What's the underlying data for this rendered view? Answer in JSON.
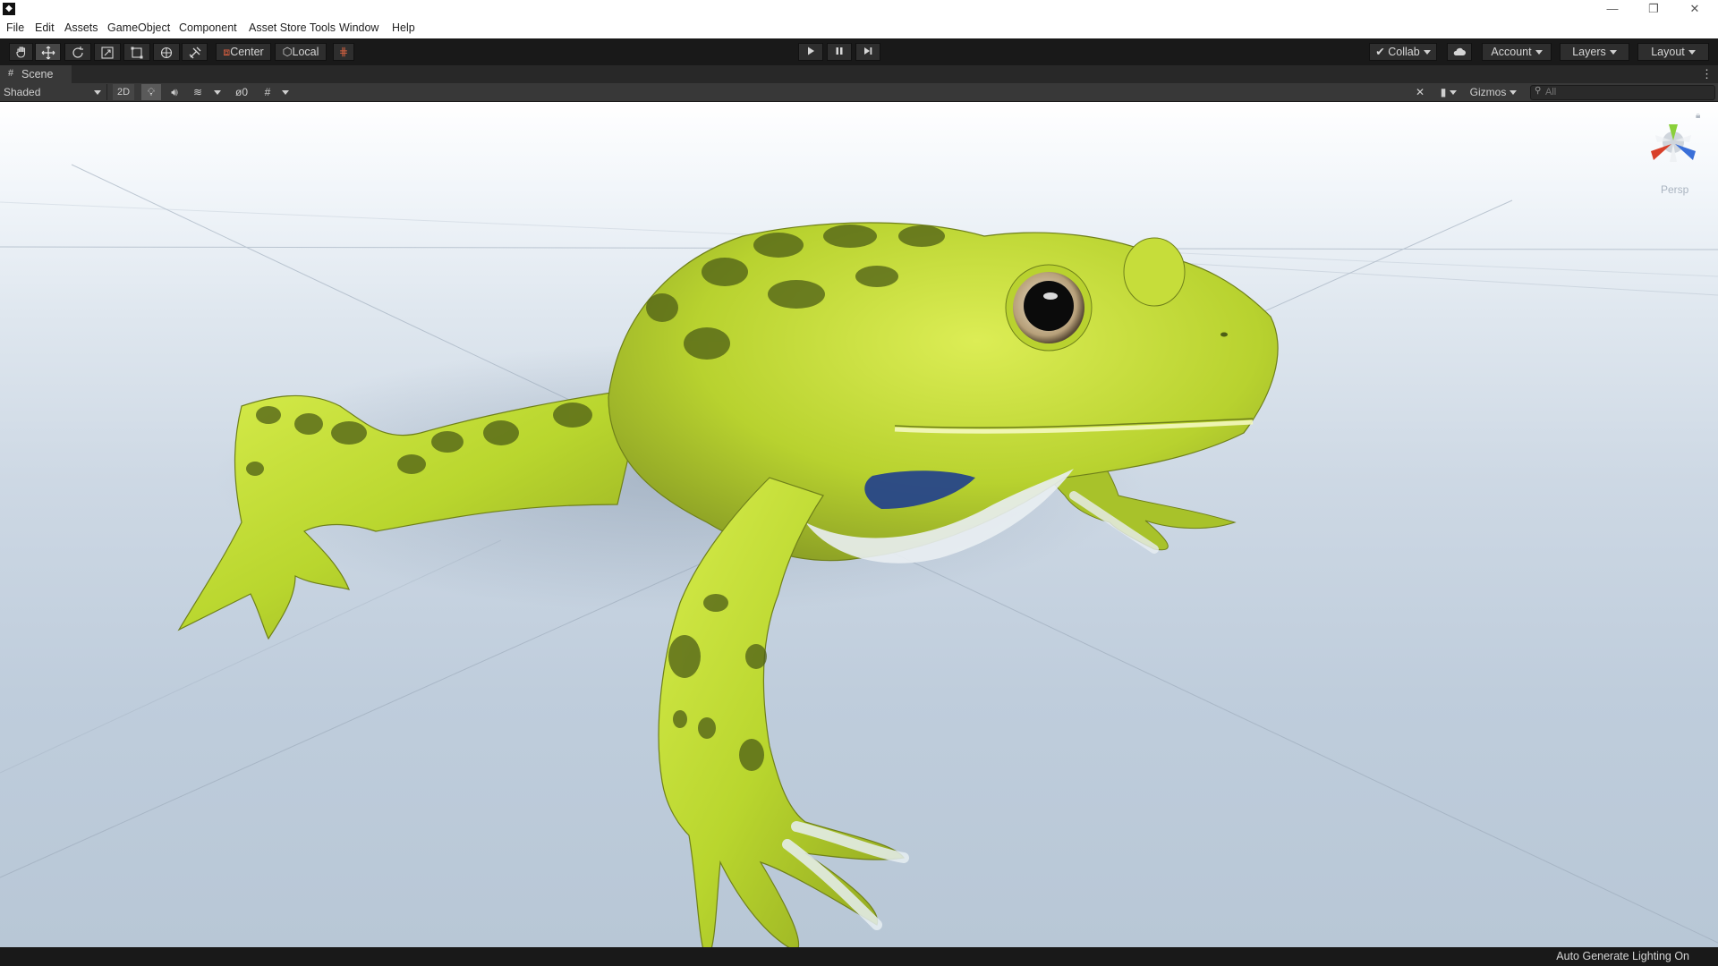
{
  "menu": [
    "File",
    "Edit",
    "Assets",
    "GameObject",
    "Component",
    "Asset Store Tools",
    "Window",
    "Help"
  ],
  "window_controls": {
    "minimize": "—",
    "restore": "❐",
    "close": "✕"
  },
  "toolbar": {
    "tools": [
      "hand-tool",
      "move-tool",
      "rotate-tool",
      "scale-tool",
      "rect-tool",
      "transform-tool",
      "custom-tool"
    ],
    "active_tool": "move-tool",
    "pivot_label": "Center",
    "space_label": "Local",
    "collab_label": "Collab",
    "account_label": "Account",
    "layers_label": "Layers",
    "layout_label": "Layout"
  },
  "scene_tab": {
    "label": "Scene"
  },
  "scene_bar": {
    "draw_mode": "Shaded",
    "mode_2d_label": "2D",
    "hidden_count": "0",
    "gizmos_label": "Gizmos",
    "search_placeholder": "All"
  },
  "viewport": {
    "projection_label": "Persp",
    "subject": "frog model"
  },
  "status": {
    "message": "Auto Generate Lighting On"
  },
  "colors": {
    "toolbar_bg": "#191919",
    "scenebar_bg": "#383838",
    "frog_green": "#b9d62e",
    "axis_x": "#d8402a",
    "axis_y": "#8ad03a",
    "axis_z": "#3a6fd8"
  }
}
